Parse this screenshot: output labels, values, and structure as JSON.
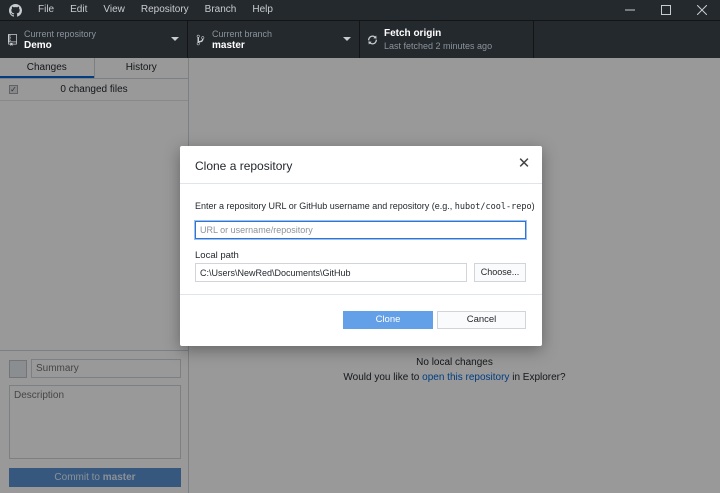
{
  "menu": {
    "items": [
      "File",
      "Edit",
      "View",
      "Repository",
      "Branch",
      "Help"
    ],
    "logo_icon": "github-octocat-icon"
  },
  "window_controls": {
    "minimize_icon": "minimize-icon",
    "maximize_icon": "maximize-icon",
    "close_icon": "close-icon"
  },
  "toolbar": {
    "repo": {
      "label": "Current repository",
      "value": "Demo",
      "icon": "repo-icon"
    },
    "branch": {
      "label": "Current branch",
      "value": "master",
      "icon": "branch-icon"
    },
    "fetch": {
      "label": "Fetch origin",
      "value": "Last fetched 2 minutes ago",
      "icon": "sync-icon"
    }
  },
  "sidebar": {
    "tabs": [
      {
        "label": "Changes",
        "active": true
      },
      {
        "label": "History",
        "active": false
      }
    ],
    "changed_files": "0 changed files",
    "summary_placeholder": "Summary",
    "description_placeholder": "Description",
    "commit_prefix": "Commit to ",
    "commit_branch": "master"
  },
  "main": {
    "no_changes": "No local changes",
    "prompt_before": "Would you like to ",
    "prompt_link": "open this repository",
    "prompt_after": " in Explorer?"
  },
  "dialog": {
    "title": "Clone a repository",
    "close_icon": "close-icon",
    "instruction_before": "Enter a repository URL or GitHub username and repository (e.g., ",
    "instruction_example": "hubot/cool-repo",
    "instruction_after": ")",
    "url_placeholder": "URL or username/repository",
    "url_value": "",
    "local_path_label": "Local path",
    "local_path_value": "C:\\Users\\NewRed\\Documents\\GitHub",
    "choose_label": "Choose...",
    "clone_label": "Clone",
    "cancel_label": "Cancel"
  },
  "colors": {
    "chrome": "#24292e",
    "accent": "#0366d6",
    "clone_button": "#64a0e8",
    "commit_button": "#5a93d4"
  }
}
